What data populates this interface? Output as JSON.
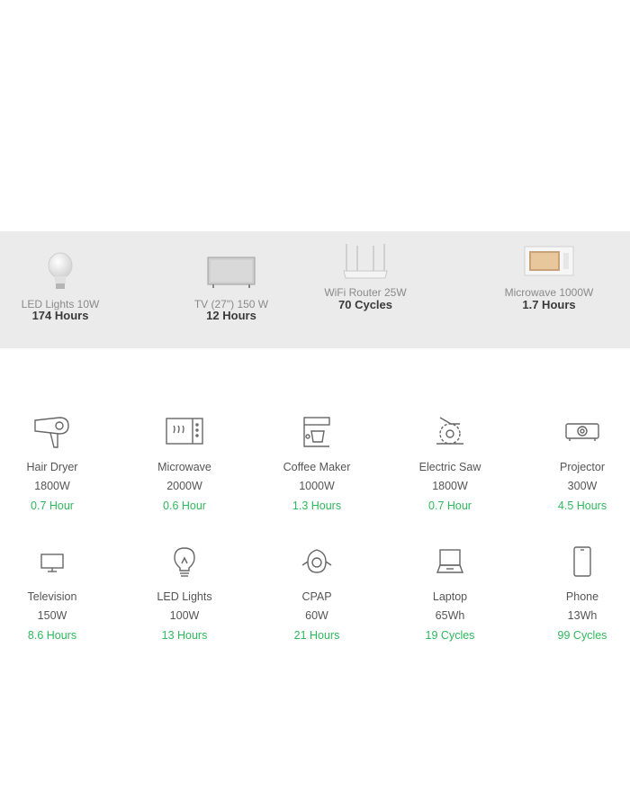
{
  "featured": [
    {
      "name": "LED Lights 10W",
      "value": "174 Hours",
      "icon": "bulb-photo"
    },
    {
      "name": "TV (27\") 150 W",
      "value": "12 Hours",
      "icon": "tv-photo"
    },
    {
      "name": "WiFi Router 25W",
      "value": "70 Cycles",
      "icon": "router-photo"
    },
    {
      "name": "Microwave 1000W",
      "value": "1.7 Hours",
      "icon": "microwave-photo"
    }
  ],
  "appliances": [
    {
      "name": "Hair Dryer",
      "watt": "1800W",
      "runtime": "0.7 Hour",
      "icon": "hair-dryer-icon"
    },
    {
      "name": "Microwave",
      "watt": "2000W",
      "runtime": "0.6 Hour",
      "icon": "microwave-icon"
    },
    {
      "name": "Coffee Maker",
      "watt": "1000W",
      "runtime": "1.3 Hours",
      "icon": "coffee-maker-icon"
    },
    {
      "name": "Electric Saw",
      "watt": "1800W",
      "runtime": "0.7 Hour",
      "icon": "electric-saw-icon"
    },
    {
      "name": "Projector",
      "watt": "300W",
      "runtime": "4.5 Hours",
      "icon": "projector-icon"
    },
    {
      "name": "Television",
      "watt": "150W",
      "runtime": "8.6 Hours",
      "icon": "television-icon"
    },
    {
      "name": "LED Lights",
      "watt": "100W",
      "runtime": "13 Hours",
      "icon": "light-bulb-icon"
    },
    {
      "name": "CPAP",
      "watt": "60W",
      "runtime": "21 Hours",
      "icon": "cpap-icon"
    },
    {
      "name": "Laptop",
      "watt": "65Wh",
      "runtime": "19 Cycles",
      "icon": "laptop-icon"
    },
    {
      "name": "Phone",
      "watt": "13Wh",
      "runtime": "99 Cycles",
      "icon": "phone-icon"
    }
  ],
  "colors": {
    "band_bg": "#ebebeb",
    "runtime_green": "#2eb85c",
    "label_gray": "#8a8a8a"
  }
}
